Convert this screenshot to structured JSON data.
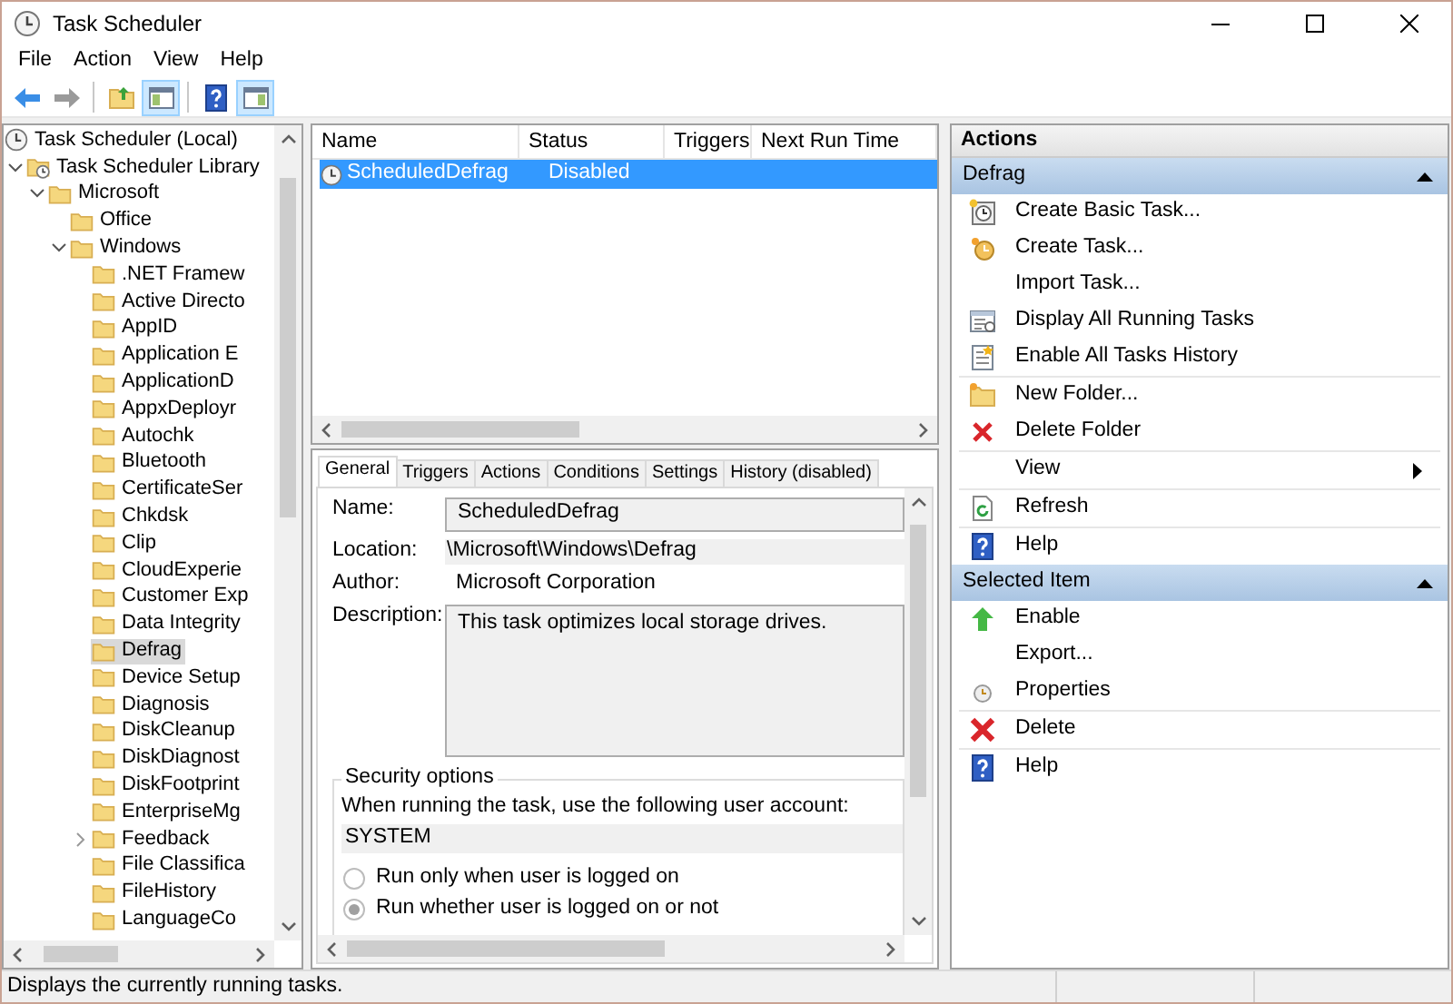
{
  "window": {
    "title": "Task Scheduler"
  },
  "menu": [
    "File",
    "Action",
    "View",
    "Help"
  ],
  "toolbar": [
    {
      "pressed": false,
      "disabled": false
    },
    {
      "pressed": false,
      "disabled": true
    },
    {
      "pressed": false,
      "disabled": false
    },
    {
      "pressed": true,
      "disabled": false
    },
    {
      "pressed": false,
      "disabled": false
    },
    {
      "pressed": true,
      "disabled": false
    }
  ],
  "tree": [
    {
      "label": "Task Scheduler (Local)",
      "selected": false,
      "children": [
        {
          "label": "Task Scheduler Library",
          "selected": false,
          "expanded": true,
          "children": [
            {
              "label": "Microsoft",
              "selected": false,
              "expanded": true,
              "children": [
                {
                  "label": "Office",
                  "selected": false
                },
                {
                  "label": "Windows",
                  "selected": false,
                  "expanded": true,
                  "children": [
                    {
                      "label": ".NET Framew",
                      "selected": false
                    },
                    {
                      "label": "Active Directo",
                      "selected": false
                    },
                    {
                      "label": "AppID",
                      "selected": false
                    },
                    {
                      "label": "Application E",
                      "selected": false
                    },
                    {
                      "label": "ApplicationD",
                      "selected": false
                    },
                    {
                      "label": "AppxDeployr",
                      "selected": false
                    },
                    {
                      "label": "Autochk",
                      "selected": false
                    },
                    {
                      "label": "Bluetooth",
                      "selected": false
                    },
                    {
                      "label": "CertificateSer",
                      "selected": false
                    },
                    {
                      "label": "Chkdsk",
                      "selected": false
                    },
                    {
                      "label": "Clip",
                      "selected": false
                    },
                    {
                      "label": "CloudExperie",
                      "selected": false
                    },
                    {
                      "label": "Customer Exp",
                      "selected": false
                    },
                    {
                      "label": "Data Integrity",
                      "selected": false
                    },
                    {
                      "label": "Defrag",
                      "selected": true
                    },
                    {
                      "label": "Device Setup",
                      "selected": false
                    },
                    {
                      "label": "Diagnosis",
                      "selected": false
                    },
                    {
                      "label": "DiskCleanup",
                      "selected": false
                    },
                    {
                      "label": "DiskDiagnost",
                      "selected": false
                    },
                    {
                      "label": "DiskFootprint",
                      "selected": false
                    },
                    {
                      "label": "EnterpriseMg",
                      "selected": false
                    },
                    {
                      "label": "Feedback",
                      "selected": false,
                      "expanded": false
                    },
                    {
                      "label": "File Classifica",
                      "selected": false
                    },
                    {
                      "label": "FileHistory",
                      "selected": false
                    },
                    {
                      "label": "LanguageCo",
                      "selected": false
                    }
                  ]
                }
              ]
            }
          ]
        }
      ]
    }
  ],
  "task_list": {
    "columns": [
      "Name",
      "Status",
      "Triggers",
      "Next Run Time"
    ],
    "rows": [
      {
        "name": "ScheduledDefrag",
        "status": "Disabled",
        "selected": true
      }
    ]
  },
  "details": {
    "tabs": [
      {
        "label": "General",
        "selected": true
      },
      {
        "label": "Triggers",
        "selected": false
      },
      {
        "label": "Actions",
        "selected": false
      },
      {
        "label": "Conditions",
        "selected": false
      },
      {
        "label": "Settings",
        "selected": false
      },
      {
        "label": "History (disabled)",
        "selected": false
      }
    ],
    "fields": [
      {
        "label": "Name:",
        "value": "ScheduledDefrag",
        "kind": "field"
      },
      {
        "label": "Location:",
        "value": "\\Microsoft\\Windows\\Defrag",
        "kind": "readonly"
      },
      {
        "label": "Author:",
        "value": "Microsoft Corporation",
        "kind": "text"
      },
      {
        "label": "Description:",
        "value": "This task optimizes local storage drives.",
        "kind": "textarea"
      }
    ],
    "security": {
      "title": "Security options",
      "prompt": "When running the task, use the following user account:",
      "account": "SYSTEM",
      "options": [
        {
          "label": "Run only when user is logged on",
          "selected": false
        },
        {
          "label": "Run whether user is logged on or not",
          "selected": true
        }
      ]
    }
  },
  "actions": {
    "title": "Actions",
    "sections": [
      {
        "title": "Defrag",
        "expanded": true,
        "groups": [
          [
            {
              "label": "Create Basic Task...",
              "kind": "command"
            },
            {
              "label": "Create Task...",
              "kind": "command"
            },
            {
              "label": "Import Task...",
              "kind": "command"
            },
            {
              "label": "Display All Running Tasks",
              "kind": "command"
            },
            {
              "label": "Enable All Tasks History",
              "kind": "command"
            }
          ],
          [
            {
              "label": "New Folder...",
              "kind": "command"
            },
            {
              "label": "Delete Folder",
              "kind": "command"
            }
          ],
          [
            {
              "label": "View",
              "kind": "submenu"
            }
          ],
          [
            {
              "label": "Refresh",
              "kind": "command"
            }
          ],
          [
            {
              "label": "Help",
              "kind": "command"
            }
          ]
        ]
      },
      {
        "title": "Selected Item",
        "expanded": true,
        "groups": [
          [
            {
              "label": "Enable",
              "kind": "command"
            },
            {
              "label": "Export...",
              "kind": "command"
            },
            {
              "label": "Properties",
              "kind": "command"
            }
          ],
          [
            {
              "label": "Delete",
              "kind": "command"
            }
          ],
          [
            {
              "label": "Help",
              "kind": "command"
            }
          ]
        ]
      }
    ]
  },
  "status_bar": {
    "text": "Displays the currently running tasks."
  }
}
